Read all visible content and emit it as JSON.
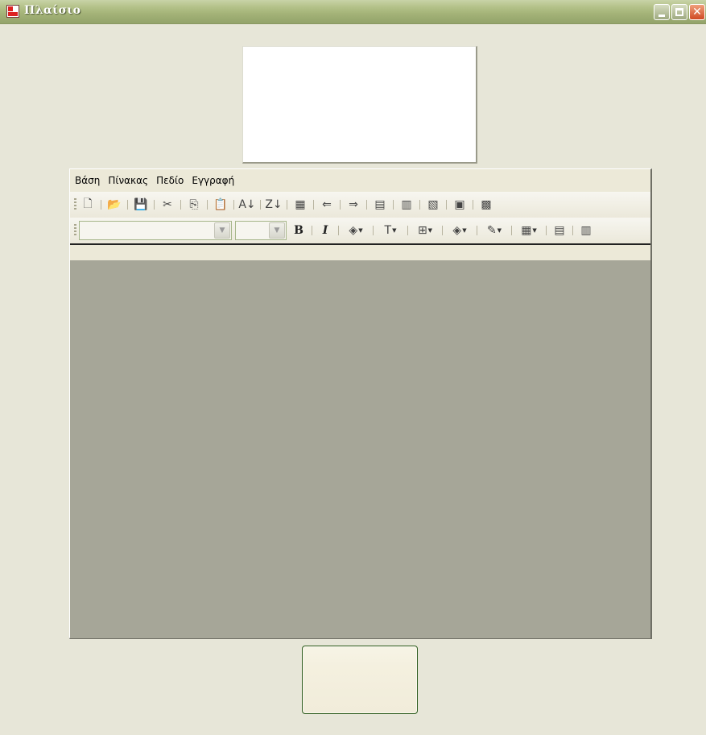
{
  "window": {
    "title": "Πλαίσιο",
    "title_icon": "form-app-icon",
    "controls": {
      "minimize_icon": "minimize-icon",
      "maximize_icon": "maximize-icon",
      "close_icon": "close-icon"
    },
    "close_glyph": "✕"
  },
  "menubar": {
    "items": [
      "Βάση",
      "Πίνακας",
      "Πεδίο",
      "Εγγραφή"
    ]
  },
  "toolbar1": {
    "buttons": [
      {
        "name": "new-document-icon",
        "glyph": "🗋"
      },
      {
        "name": "open-folder-icon",
        "glyph": "📂"
      },
      {
        "name": "save-icon",
        "glyph": "💾"
      },
      {
        "name": "cut-icon",
        "glyph": "✂"
      },
      {
        "name": "copy-icon",
        "glyph": "⎘"
      },
      {
        "name": "paste-icon",
        "glyph": "📋"
      },
      {
        "name": "sort-ascending-icon",
        "glyph": "A↓"
      },
      {
        "name": "sort-descending-icon",
        "glyph": "Z↓"
      },
      {
        "name": "filter-icon",
        "glyph": "▦"
      },
      {
        "name": "find-previous-icon",
        "glyph": "⇐"
      },
      {
        "name": "find-next-icon",
        "glyph": "⇒"
      },
      {
        "name": "add-record-icon",
        "glyph": "▤"
      },
      {
        "name": "delete-record-icon",
        "glyph": "▥"
      },
      {
        "name": "edit-record-icon",
        "glyph": "▧"
      },
      {
        "name": "insert-field-icon",
        "glyph": "▣"
      },
      {
        "name": "delete-field-icon",
        "glyph": "▩"
      }
    ]
  },
  "toolbar2": {
    "font_combo_value": "",
    "size_combo_value": "",
    "bold_label": "B",
    "italic_label": "I",
    "buttons": [
      {
        "name": "fill-color-icon",
        "glyph": "◈"
      },
      {
        "name": "font-color-icon",
        "glyph": "T"
      },
      {
        "name": "border-style-icon",
        "glyph": "⊞"
      },
      {
        "name": "background-color-icon",
        "glyph": "◈"
      },
      {
        "name": "format-painter-icon",
        "glyph": "✎"
      },
      {
        "name": "grid-lines-icon",
        "glyph": "▦"
      }
    ],
    "extra": [
      {
        "name": "columns-icon",
        "glyph": "▤"
      },
      {
        "name": "table-icon",
        "glyph": "▥"
      }
    ],
    "combo_arrow": "▼"
  }
}
